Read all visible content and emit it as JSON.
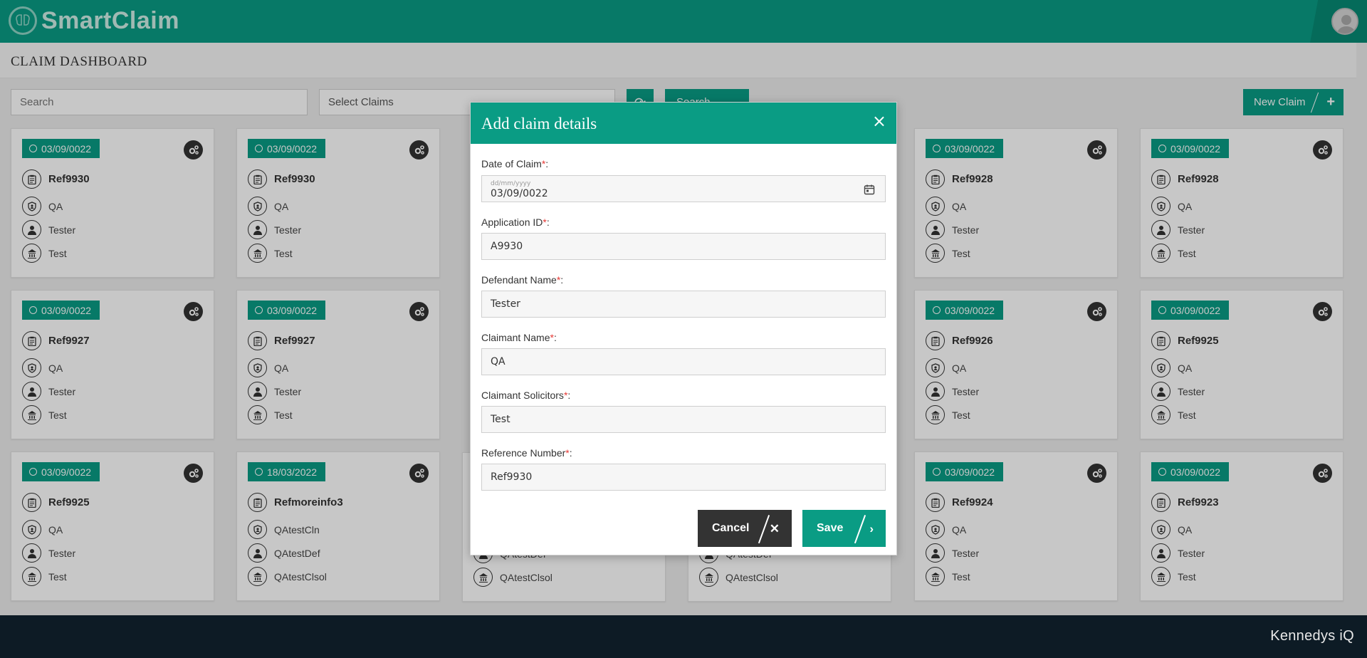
{
  "header": {
    "app_name": "SmartClaim"
  },
  "page": {
    "title": "CLAIM DASHBOARD"
  },
  "filters": {
    "search_placeholder": "Search",
    "select_label": "Select Claims",
    "search_button": "Search",
    "new_claim_button": "New Claim"
  },
  "cards": [
    {
      "date": "03/09/0022",
      "ref": "Ref9930",
      "claimant": "QA",
      "defendant": "Tester",
      "solicitor": "Test"
    },
    {
      "date": "03/09/0022",
      "ref": "Ref9930",
      "claimant": "QA",
      "defendant": "Tester",
      "solicitor": "Test"
    },
    {
      "date": "03/09/0022",
      "ref": "Ref9928",
      "claimant": "QA",
      "defendant": "Tester",
      "solicitor": "Test"
    },
    {
      "date": "03/09/0022",
      "ref": "Ref9928",
      "claimant": "QA",
      "defendant": "Tester",
      "solicitor": "Test"
    },
    {
      "date": "03/09/0022",
      "ref": "Ref9927",
      "claimant": "QA",
      "defendant": "Tester",
      "solicitor": "Test"
    },
    {
      "date": "03/09/0022",
      "ref": "Ref9927",
      "claimant": "QA",
      "defendant": "Tester",
      "solicitor": "Test"
    },
    {
      "date": "03/09/0022",
      "ref": "Ref9926",
      "claimant": "QA",
      "defendant": "Tester",
      "solicitor": "Test"
    },
    {
      "date": "03/09/0022",
      "ref": "Ref9925",
      "claimant": "QA",
      "defendant": "Tester",
      "solicitor": "Test"
    },
    {
      "date": "03/09/0022",
      "ref": "Ref9925",
      "claimant": "QA",
      "defendant": "Tester",
      "solicitor": "Test"
    },
    {
      "date": "18/03/2022",
      "ref": "Refmoreinfo3",
      "claimant": "QAtestCln",
      "defendant": "QAtestDef",
      "solicitor": "QAtestClsol"
    },
    {
      "date": "03/09/0022",
      "ref": "Ref9924",
      "claimant": "QA",
      "defendant": "Tester",
      "solicitor": "Test"
    },
    {
      "date": "03/09/0022",
      "ref": "Ref9923",
      "claimant": "QA",
      "defendant": "Tester",
      "solicitor": "Test"
    }
  ],
  "partial_rows": {
    "col3_defendant": "QAtestDef",
    "col3_solicitor": "QAtestClsol",
    "col4_defendant": "QAtestDef",
    "col4_solicitor": "QAtestClsol"
  },
  "modal": {
    "title": "Add claim details",
    "close": "×",
    "fields": {
      "date_of_claim": {
        "label": "Date of Claim",
        "placeholder": "dd/mm/yyyy",
        "value": "03/09/0022"
      },
      "application_id": {
        "label": "Application ID",
        "value": "A9930"
      },
      "defendant_name": {
        "label": "Defendant Name",
        "value": "Tester"
      },
      "claimant_name": {
        "label": "Claimant Name",
        "value": "QA"
      },
      "claimant_solicitors": {
        "label": "Claimant Solicitors",
        "value": "Test"
      },
      "reference_number": {
        "label": "Reference Number",
        "value": "Ref9930"
      }
    },
    "required_mark": "*",
    "label_suffix": ":",
    "cancel_label": "Cancel",
    "save_label": "Save"
  },
  "footer": {
    "brand": "Kennedys iQ"
  },
  "colors": {
    "primary": "#0a9c84",
    "dark": "#333333",
    "footer": "#0d1b25",
    "required": "#e53935"
  }
}
